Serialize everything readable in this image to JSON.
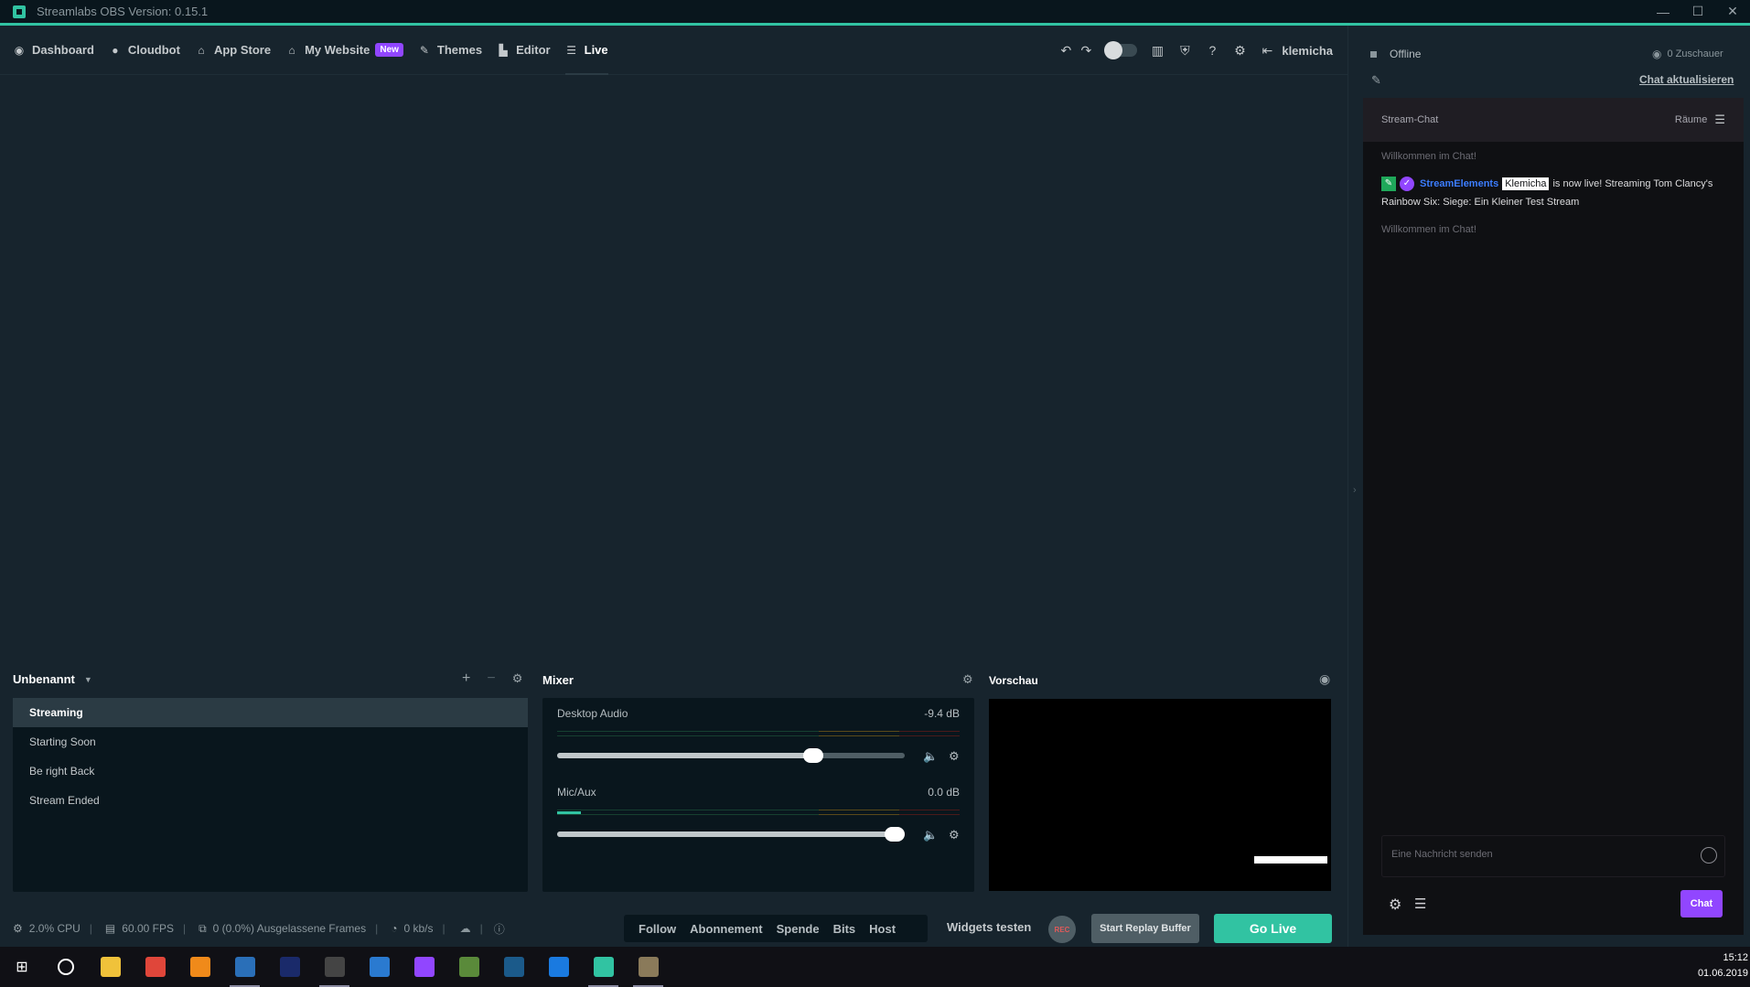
{
  "window": {
    "title": "Streamlabs OBS   Version: 0.15.1",
    "controls": [
      "—",
      "☐",
      "✕"
    ]
  },
  "nav": {
    "dashboard": "Dashboard",
    "cloudbot": "Cloudbot",
    "app_store": "App Store",
    "my_website": "My Website",
    "new_badge": "New",
    "themes": "Themes",
    "editor": "Editor",
    "live": "Live",
    "user": "klemicha"
  },
  "scenes": {
    "collection": "Unbenannt",
    "items": [
      "Streaming",
      "Starting Soon",
      "Be right Back",
      "Stream Ended"
    ]
  },
  "mixer": {
    "title": "Mixer",
    "channels": [
      {
        "name": "Desktop Audio",
        "db": "-9.4 dB",
        "volume": 0.75,
        "level": 0.0
      },
      {
        "name": "Mic/Aux",
        "db": "0.0 dB",
        "volume": 1.0,
        "level": 0.06
      }
    ]
  },
  "preview": {
    "title": "Vorschau"
  },
  "status": {
    "cpu": "2.0% CPU",
    "fps": "60.00 FPS",
    "dropped": "0 (0.0%) Ausgelassene Frames",
    "bitrate": "0 kb/s"
  },
  "alerts": [
    "Follow",
    "Abonnement",
    "Spende",
    "Bits",
    "Host"
  ],
  "actions": {
    "widgets_test": "Widgets testen",
    "rec": "REC",
    "replay": "Start Replay Buffer",
    "go_live": "Go Live"
  },
  "chat": {
    "status": "Offline",
    "viewers": "0 Zuschauer",
    "refresh": "Chat aktualisieren",
    "header": "Stream-Chat",
    "rooms": "Räume",
    "welcome": "Willkommen im Chat!",
    "message": {
      "user": "StreamElements",
      "mention": "Klemicha",
      "text": "is now live! Streaming Tom Clancy's Rainbow Six: Siege: Ein Kleiner Test Stream"
    },
    "input_placeholder": "Eine Nachricht senden",
    "send_button": "Chat"
  },
  "taskbar": {
    "time": "15:12",
    "date": "01.06.2019",
    "apps": [
      {
        "name": "file-explorer",
        "color": "#f0c23a",
        "running": false
      },
      {
        "name": "chrome",
        "color": "#e0463a",
        "running": false
      },
      {
        "name": "vlc",
        "color": "#f08a1a",
        "running": false
      },
      {
        "name": "streamlabs-chatbot",
        "color": "#2a6fb8",
        "running": true
      },
      {
        "name": "photoshop",
        "color": "#1a2a6a",
        "running": false
      },
      {
        "name": "unity",
        "color": "#444444",
        "running": true
      },
      {
        "name": "outlook",
        "color": "#2a7ad0",
        "running": false
      },
      {
        "name": "twitch",
        "color": "#9146ff",
        "running": false
      },
      {
        "name": "minecraft",
        "color": "#5a8a3a",
        "running": false
      },
      {
        "name": "steam",
        "color": "#1b5a8a",
        "running": false
      },
      {
        "name": "uplay",
        "color": "#1a7ae0",
        "running": false
      },
      {
        "name": "streamlabs-obs",
        "color": "#31c3a2",
        "running": true
      },
      {
        "name": "assassins-creed",
        "color": "#8a7a5a",
        "running": true
      }
    ]
  }
}
